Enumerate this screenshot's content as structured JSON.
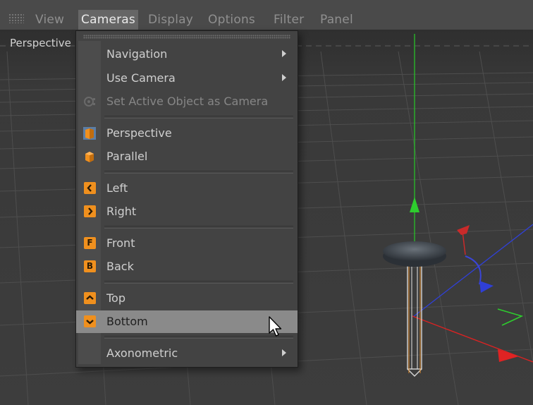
{
  "menubar": {
    "items": [
      {
        "label": "View"
      },
      {
        "label": "Cameras"
      },
      {
        "label": "Display"
      },
      {
        "label": "Options"
      },
      {
        "label": "Filter"
      },
      {
        "label": "Panel"
      }
    ],
    "active_label": "Cameras"
  },
  "viewport": {
    "label": "Perspective"
  },
  "cameras_menu": {
    "items": [
      {
        "label": "Navigation",
        "submenu": true
      },
      {
        "label": "Use Camera",
        "submenu": true
      },
      {
        "label": "Set Active Object as Camera",
        "enabled": false,
        "icon": "camera-object-icon"
      },
      {
        "label": "Perspective",
        "icon": "perspective-cube-icon"
      },
      {
        "label": "Parallel",
        "icon": "parallel-cube-icon"
      },
      {
        "label": "Left",
        "icon": "left-view-icon",
        "icon_glyph": "<"
      },
      {
        "label": "Right",
        "icon": "right-view-icon",
        "icon_glyph": ">"
      },
      {
        "label": "Front",
        "icon": "front-view-icon",
        "icon_glyph": "F"
      },
      {
        "label": "Back",
        "icon": "back-view-icon",
        "icon_glyph": "B"
      },
      {
        "label": "Top",
        "icon": "top-view-icon",
        "icon_glyph": "^"
      },
      {
        "label": "Bottom",
        "icon": "bottom-view-icon",
        "icon_glyph": "v",
        "highlighted": true
      },
      {
        "label": "Axonometric",
        "submenu": true
      }
    ]
  },
  "colors": {
    "menubar_bg": "#4a4a4a",
    "menu_bg": "#434343",
    "highlight": "#8a8a8a",
    "icon_orange": "#f0901e",
    "axis_x": "#d62b2b",
    "axis_y": "#23b823",
    "axis_z": "#2f3fd6",
    "grid_line": "#555555"
  }
}
